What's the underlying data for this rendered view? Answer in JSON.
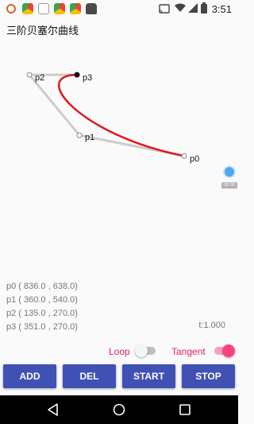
{
  "status_bar": {
    "time": "3:51",
    "icons": [
      "android-icon",
      "chrome-icon",
      "chrome-icon",
      "white-square-icon",
      "chrome-icon",
      "android-icon",
      "cast-icon",
      "wifi-icon",
      "signal-icon",
      "battery-icon"
    ]
  },
  "app": {
    "title": "三阶贝塞尔曲线"
  },
  "canvas": {
    "points": [
      {
        "label": "p0"
      },
      {
        "label": "p1"
      },
      {
        "label": "p2"
      },
      {
        "label": "p3"
      }
    ],
    "curve_color": "#e0161a",
    "control_line_color": "#cccccc"
  },
  "coords": {
    "p0": "p0 ( 836.0 , 638.0)",
    "p1": "p1 ( 360.0 , 540.0)",
    "p2": "p2 ( 135.0 , 270.0)",
    "p3": "p3 ( 351.0 , 270.0)",
    "t": "t:1.000"
  },
  "controls": {
    "loop_label": "Loop",
    "loop_on": false,
    "tangent_label": "Tangent",
    "tangent_on": true,
    "accent_color": "#e91e63"
  },
  "buttons": {
    "add": "ADD",
    "del": "DEL",
    "start": "START",
    "stop": "STOP",
    "color": "#3f51b5"
  },
  "floating": {
    "label": "00:00"
  }
}
